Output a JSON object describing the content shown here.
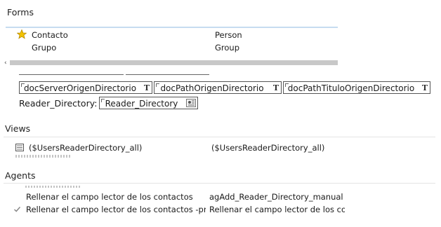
{
  "forms": {
    "title": "Forms",
    "rows": [
      {
        "name": "Contacto",
        "alias": "Person",
        "icon": "star-icon"
      },
      {
        "name": "Grupo",
        "alias": "Group",
        "icon": ""
      }
    ]
  },
  "design": {
    "fields": [
      "docServerOrigenDirectorio",
      "docPathOrigenDirectorio",
      "docPathTituloOrigenDirectorio"
    ],
    "field_type_glyph": "T",
    "reader_label": "Reader_Directory:",
    "reader_field": "Reader_Directory"
  },
  "views": {
    "title": "Views",
    "rows": [
      {
        "name": "($UsersReaderDirectory_all)",
        "alias": "($UsersReaderDirectory_all)",
        "icon": "view-icon"
      }
    ]
  },
  "agents": {
    "title": "Agents",
    "rows": [
      {
        "name": "Rellenar el campo lector de los contactos",
        "alias": "agAdd_Reader_Directory_manual",
        "icon": ""
      },
      {
        "name": "Rellenar el campo lector de los contactos -progra",
        "alias": "Rellenar el campo lector de los co...",
        "icon": "check-icon"
      }
    ]
  },
  "colors": {
    "accent_line": "#c6dcf0",
    "star": "#e8b200",
    "scrollbar": "#c8c8c8"
  }
}
